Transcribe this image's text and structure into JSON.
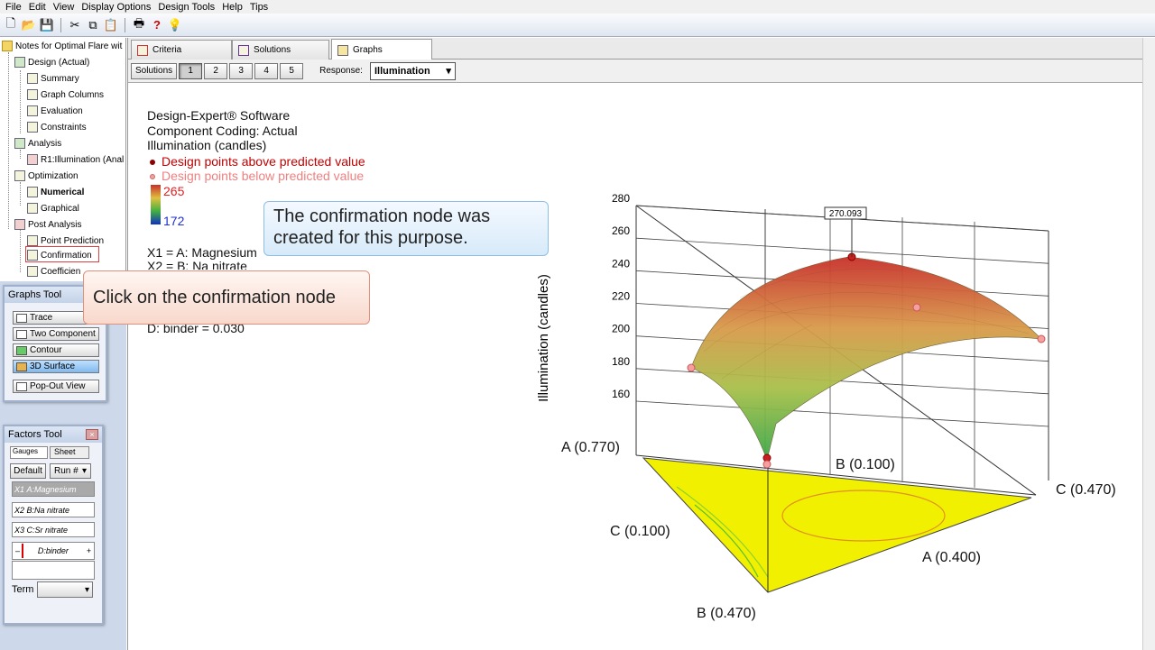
{
  "menu": [
    "File",
    "Edit",
    "View",
    "Display Options",
    "Design Tools",
    "Help",
    "Tips"
  ],
  "toolbar": {
    "icons": [
      "new-icon",
      "open-icon",
      "save-icon",
      "cut-icon",
      "copy-icon",
      "paste-icon",
      "print-icon",
      "help-icon",
      "tip-icon"
    ]
  },
  "tree": {
    "root": "Notes for Optimal Flare wit",
    "items": [
      {
        "label": "Design (Actual)",
        "bold": false
      },
      {
        "label": "Summary",
        "bold": false
      },
      {
        "label": "Graph Columns",
        "bold": false
      },
      {
        "label": "Evaluation",
        "bold": false
      },
      {
        "label": "Constraints",
        "bold": false
      },
      {
        "label": "Analysis",
        "bold": false
      },
      {
        "label": "R1:Illumination (Anal",
        "bold": false
      },
      {
        "label": "Optimization",
        "bold": false
      },
      {
        "label": "Numerical",
        "bold": true
      },
      {
        "label": "Graphical",
        "bold": false
      },
      {
        "label": "Post Analysis",
        "bold": false
      },
      {
        "label": "Point Prediction",
        "bold": false
      },
      {
        "label": "Confirmation",
        "bold": false
      },
      {
        "label": "Coefficien",
        "bold": false
      }
    ]
  },
  "graphs_tool": {
    "title": "Graphs Tool",
    "buttons": [
      "Trace",
      "Two Component",
      "Contour",
      "3D Surface",
      "Pop-Out View"
    ]
  },
  "factors_tool": {
    "title": "Factors Tool",
    "tabs": [
      "Gauges",
      "Sheet"
    ],
    "default_label": "Default",
    "run_label": "Run #",
    "factors": [
      {
        "code": "X1",
        "name": "A:Magnesium"
      },
      {
        "code": "X2",
        "name": "B:Na nitrate"
      },
      {
        "code": "X3",
        "name": "C:Sr nitrate"
      }
    ],
    "slider_name": "D:binder",
    "slider_minus": "–",
    "slider_plus": "+",
    "term_label": "Term"
  },
  "tabs": [
    "Criteria",
    "Solutions",
    "Graphs"
  ],
  "subbar": {
    "solutions_label": "Solutions",
    "numbers": [
      "1",
      "2",
      "3",
      "4",
      "5"
    ],
    "response_label": "Response:",
    "response_value": "Illumination"
  },
  "legend": {
    "line1": "Design-Expert® Software",
    "line2": "Component Coding: Actual",
    "line3": "Illumination (candles)",
    "above": "Design points above predicted value",
    "below": "Design points below predicted value",
    "max": "265",
    "min": "172",
    "x1": "X1 = A: Magnesium",
    "x2": "X2 = B: Na nitrate",
    "binder": "D: binder = 0.030"
  },
  "callouts": {
    "blue": "The confirmation node was created for this purpose.",
    "red": "Click on the confirmation node"
  },
  "chart_data": {
    "type": "3d-surface",
    "zlabel": "Illumination (candles)",
    "z_ticks": [
      160,
      180,
      200,
      220,
      240,
      260,
      280
    ],
    "zlim": [
      160,
      280
    ],
    "flag_label": "270.093",
    "vertex_labels": [
      "A (0.770)",
      "B (0.100)",
      "C (0.470)",
      "C (0.100)",
      "A (0.400)",
      "B (0.470)"
    ],
    "colors": {
      "high": "#c8302a",
      "mid": "#d8c84a",
      "low": "#3aa84a",
      "floor": "#f0f000"
    }
  }
}
